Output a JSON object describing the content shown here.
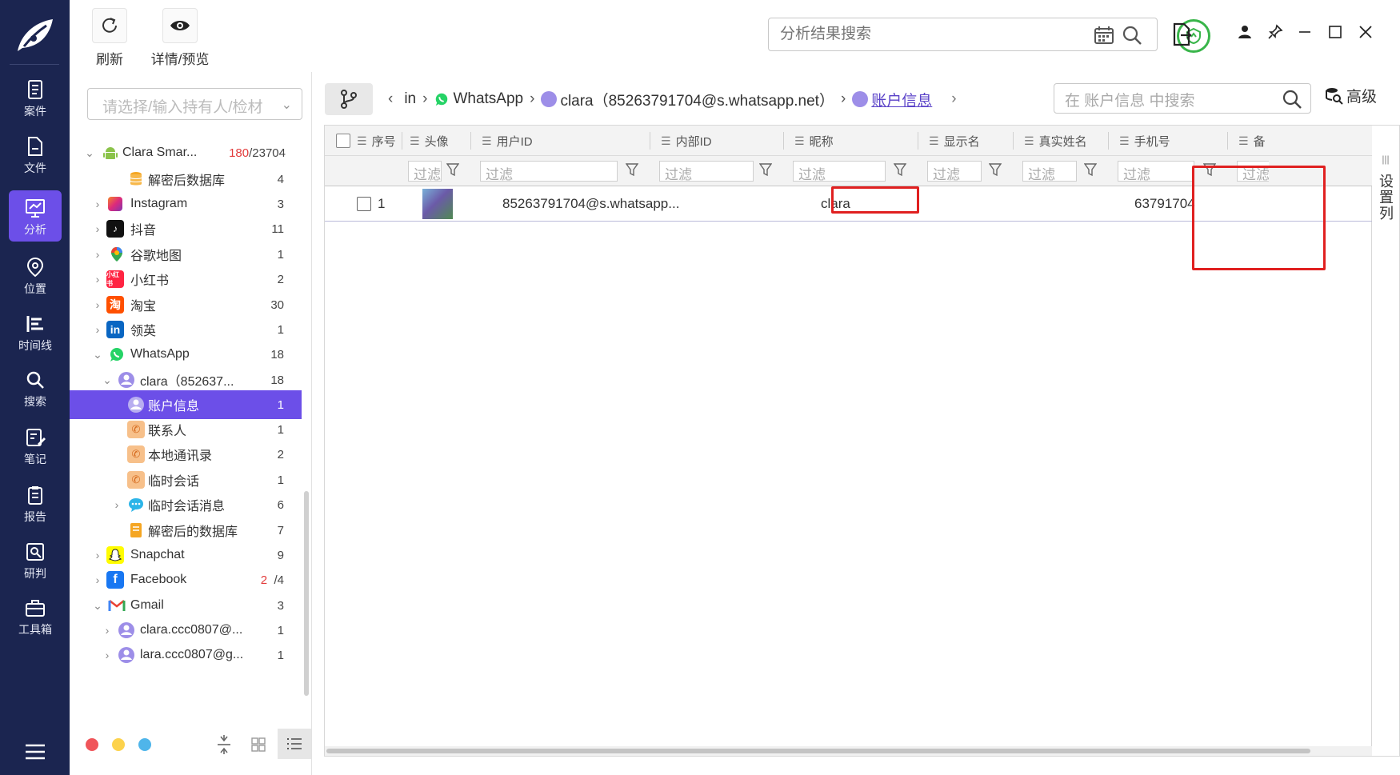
{
  "nav": {
    "items": [
      {
        "label": "案件",
        "icon": "case-icon"
      },
      {
        "label": "文件",
        "icon": "file-icon"
      },
      {
        "label": "分析",
        "icon": "analysis-icon"
      },
      {
        "label": "位置",
        "icon": "location-icon"
      },
      {
        "label": "时间线",
        "icon": "timeline-icon"
      },
      {
        "label": "搜索",
        "icon": "search-icon"
      },
      {
        "label": "笔记",
        "icon": "notes-icon"
      },
      {
        "label": "报告",
        "icon": "report-icon"
      },
      {
        "label": "研判",
        "icon": "judgment-icon"
      },
      {
        "label": "工具箱",
        "icon": "toolbox-icon"
      }
    ],
    "active": "分析"
  },
  "toolbar": {
    "refresh_label": "刷新",
    "details_label": "详情/预览",
    "search_placeholder": "分析结果搜索"
  },
  "tree": {
    "search_placeholder": "请选择/输入持有人/检材",
    "device": {
      "label": "Clara Smar...",
      "count_red": "180",
      "count_total": "/23704"
    },
    "rows": [
      {
        "label": "解密后数据库",
        "count": "4"
      },
      {
        "label": "Instagram",
        "count": "3"
      },
      {
        "label": "抖音",
        "count": "11"
      },
      {
        "label": "谷歌地图",
        "count": "1"
      },
      {
        "label": "小红书",
        "count": "2"
      },
      {
        "label": "淘宝",
        "count": "30"
      },
      {
        "label": "领英",
        "count": "1"
      },
      {
        "label": "WhatsApp",
        "count": "18"
      },
      {
        "label": "clara（852637...",
        "count": "18"
      },
      {
        "label": "账户信息",
        "count": "1"
      },
      {
        "label": "联系人",
        "count": "1"
      },
      {
        "label": "本地通讯录",
        "count": "2"
      },
      {
        "label": "临时会话",
        "count": "1"
      },
      {
        "label": "临时会话消息",
        "count": "6"
      },
      {
        "label": "解密后的数据库",
        "count": "7"
      },
      {
        "label": "Snapchat",
        "count": "9"
      },
      {
        "label": "Facebook",
        "count_red": "2",
        "count": "/4"
      },
      {
        "label": "Gmail",
        "count": "3"
      },
      {
        "label": "clara.ccc0807@...",
        "count": "1"
      },
      {
        "label": "lara.ccc0807@g...",
        "count": "1"
      }
    ],
    "icon_text": {
      "xiaohongshu": "小红书",
      "taobao": "淘",
      "linkedin": "in"
    }
  },
  "breadcrumb": {
    "prev": "in",
    "app": "WhatsApp",
    "account": "clara（85263791704@s.whatsapp.net）",
    "current": "账户信息"
  },
  "main": {
    "search_placeholder": "在 账户信息 中搜索",
    "advanced_label": "高级",
    "set_columns_label": "设置列"
  },
  "grid": {
    "columns": [
      "序号",
      "头像",
      "用户ID",
      "内部ID",
      "昵称",
      "显示名",
      "真实姓名",
      "手机号",
      "备"
    ],
    "filter_placeholder": "过滤",
    "rows": [
      {
        "index": "1",
        "user_id": "85263791704@s.whatsapp...",
        "internal_id": "",
        "nickname": "clara",
        "display_name": "",
        "real_name": "",
        "phone": "63791704"
      }
    ]
  },
  "colors": {
    "nav_bg": "#1b2550",
    "accent": "#6c4fe8",
    "highlight_box": "#e02020",
    "shield": "#39b54a"
  }
}
